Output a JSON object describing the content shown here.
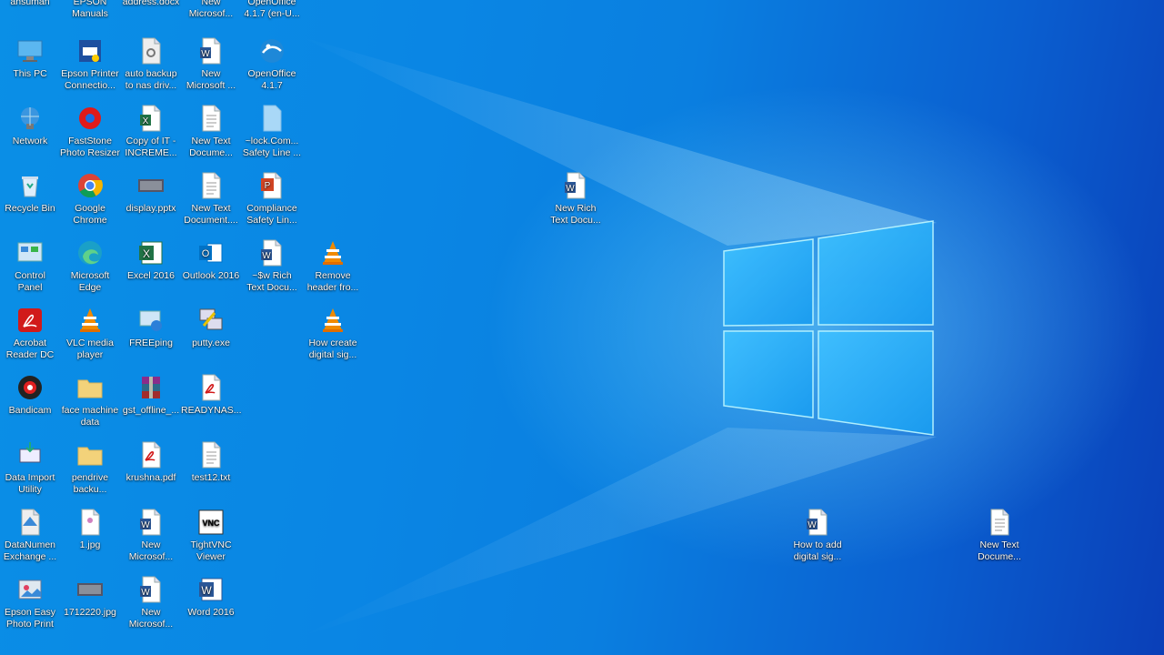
{
  "desktop": {
    "icons": [
      {
        "label": "ansuman",
        "icon": "user-folder-icon"
      },
      {
        "label": "EPSON\nManuals",
        "icon": "epson-manuals-icon"
      },
      {
        "label": "address.docx",
        "icon": "word-doc-icon"
      },
      {
        "label": "New\nMicrosof...",
        "icon": "word-doc-icon"
      },
      {
        "label": "OpenOffice\n4.1.7 (en-U...",
        "icon": "openoffice-icon"
      },
      {
        "label": "This PC",
        "icon": "computer-icon"
      },
      {
        "label": "Epson Printer\nConnectio...",
        "icon": "epson-printer-icon"
      },
      {
        "label": "auto backup\nto nas driv...",
        "icon": "settings-file-icon"
      },
      {
        "label": "New\nMicrosoft ...",
        "icon": "word-doc-icon"
      },
      {
        "label": "OpenOffice\n4.1.7",
        "icon": "openoffice-icon"
      },
      {
        "label": "Network",
        "icon": "network-icon"
      },
      {
        "label": "FastStone\nPhoto Resizer",
        "icon": "faststone-icon"
      },
      {
        "label": "Copy of IT -\nINCREME...",
        "icon": "excel-file-icon"
      },
      {
        "label": "New Text\nDocume...",
        "icon": "text-file-icon"
      },
      {
        "label": "~lock.Com...\nSafety Line ...",
        "icon": "blank-file-icon"
      },
      {
        "label": "Recycle Bin",
        "icon": "recycle-bin-icon"
      },
      {
        "label": "Google\nChrome",
        "icon": "chrome-icon"
      },
      {
        "label": "display.pptx",
        "icon": "image-thumb-icon"
      },
      {
        "label": "New Text\nDocument....",
        "icon": "text-file-icon"
      },
      {
        "label": "Compliance\nSafety Lin...",
        "icon": "powerpoint-icon"
      },
      {
        "label": "Control\nPanel",
        "icon": "control-panel-icon"
      },
      {
        "label": "Microsoft\nEdge",
        "icon": "edge-icon"
      },
      {
        "label": "Excel 2016",
        "icon": "excel-app-icon"
      },
      {
        "label": "Outlook 2016",
        "icon": "outlook-icon"
      },
      {
        "label": "~$w Rich\nText Docu...",
        "icon": "word-doc-icon"
      },
      {
        "label": "Remove\nheader fro...",
        "icon": "vlc-icon"
      },
      {
        "label": "Acrobat\nReader DC",
        "icon": "acrobat-icon"
      },
      {
        "label": "VLC media\nplayer",
        "icon": "vlc-icon"
      },
      {
        "label": "FREEping",
        "icon": "freeping-icon"
      },
      {
        "label": "putty.exe",
        "icon": "putty-icon"
      },
      {
        "label": "How create\ndigital sig...",
        "icon": "vlc-icon"
      },
      {
        "label": "Bandicam",
        "icon": "bandicam-icon"
      },
      {
        "label": "face machine\ndata",
        "icon": "folder-icon"
      },
      {
        "label": "gst_offline_...",
        "icon": "winrar-icon"
      },
      {
        "label": "READYNAS...",
        "icon": "pdf-icon"
      },
      {
        "label": "Data Import\nUtility",
        "icon": "data-import-icon"
      },
      {
        "label": "pendrive\nbacku...",
        "icon": "folder-icon"
      },
      {
        "label": "krushna.pdf",
        "icon": "pdf-icon"
      },
      {
        "label": "test12.txt",
        "icon": "text-file-icon"
      },
      {
        "label": "DataNumen\nExchange ...",
        "icon": "datanumen-icon"
      },
      {
        "label": "1.jpg",
        "icon": "image-file-icon"
      },
      {
        "label": "New\nMicrosof...",
        "icon": "word-doc-icon"
      },
      {
        "label": "TightVNC\nViewer",
        "icon": "tightvnc-icon"
      },
      {
        "label": "Epson Easy\nPhoto Print",
        "icon": "epson-photo-icon"
      },
      {
        "label": "1712220.jpg",
        "icon": "image-thumb-icon"
      },
      {
        "label": "New\nMicrosof...",
        "icon": "word-doc-icon"
      },
      {
        "label": "Word 2016",
        "icon": "word-app-icon"
      },
      {
        "label": "New Rich\nText Docu...",
        "icon": "word-doc-icon"
      },
      {
        "label": "How to add\ndigital sig...",
        "icon": "word-doc-icon"
      },
      {
        "label": "New Text\nDocume...",
        "icon": "text-file-icon"
      }
    ]
  },
  "colors": {
    "wallpaper_accent": "#0a86e4",
    "logo_glow": "#7fe3ff"
  }
}
